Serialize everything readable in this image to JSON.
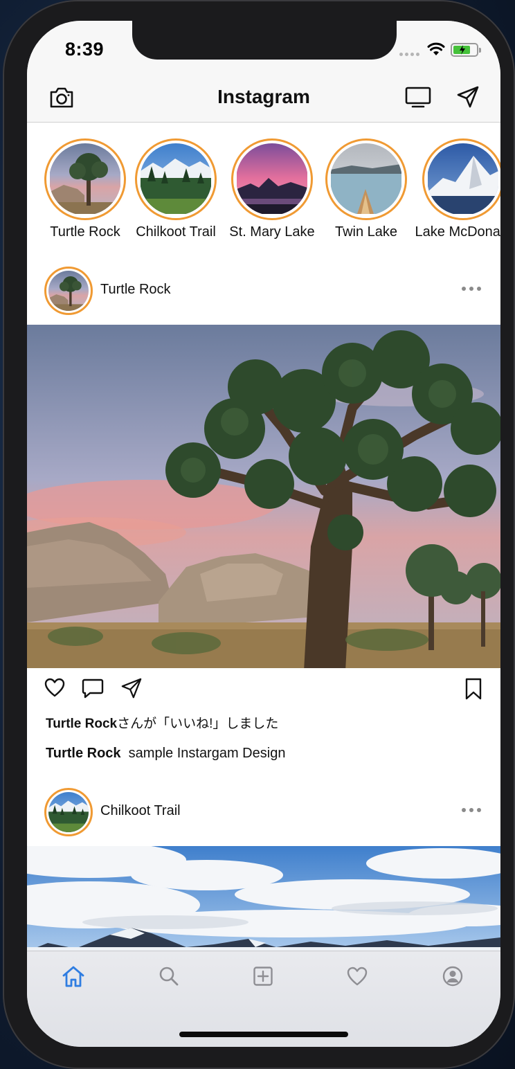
{
  "status_bar": {
    "time": "8:39"
  },
  "nav": {
    "title": "Instagram"
  },
  "stories": [
    {
      "label": "Turtle Rock"
    },
    {
      "label": "Chilkoot Trail"
    },
    {
      "label": "St. Mary Lake"
    },
    {
      "label": "Twin Lake"
    },
    {
      "label": "Lake McDonald"
    }
  ],
  "posts": [
    {
      "username": "Turtle Rock",
      "likes_user": "Turtle Rock",
      "likes_text": "さんが「いいね!」しました",
      "caption_user": "Turtle Rock",
      "caption_text": "sample Instargam Design"
    },
    {
      "username": "Chilkoot Trail"
    }
  ],
  "colors": {
    "story_ring": "#f09a33",
    "tab_active": "#2f7de1",
    "tab_inactive": "#8e8e93"
  },
  "tab_bar": {
    "items": [
      "home-icon",
      "search-icon",
      "add-icon",
      "heart-icon",
      "profile-icon"
    ],
    "active": "home-icon"
  }
}
